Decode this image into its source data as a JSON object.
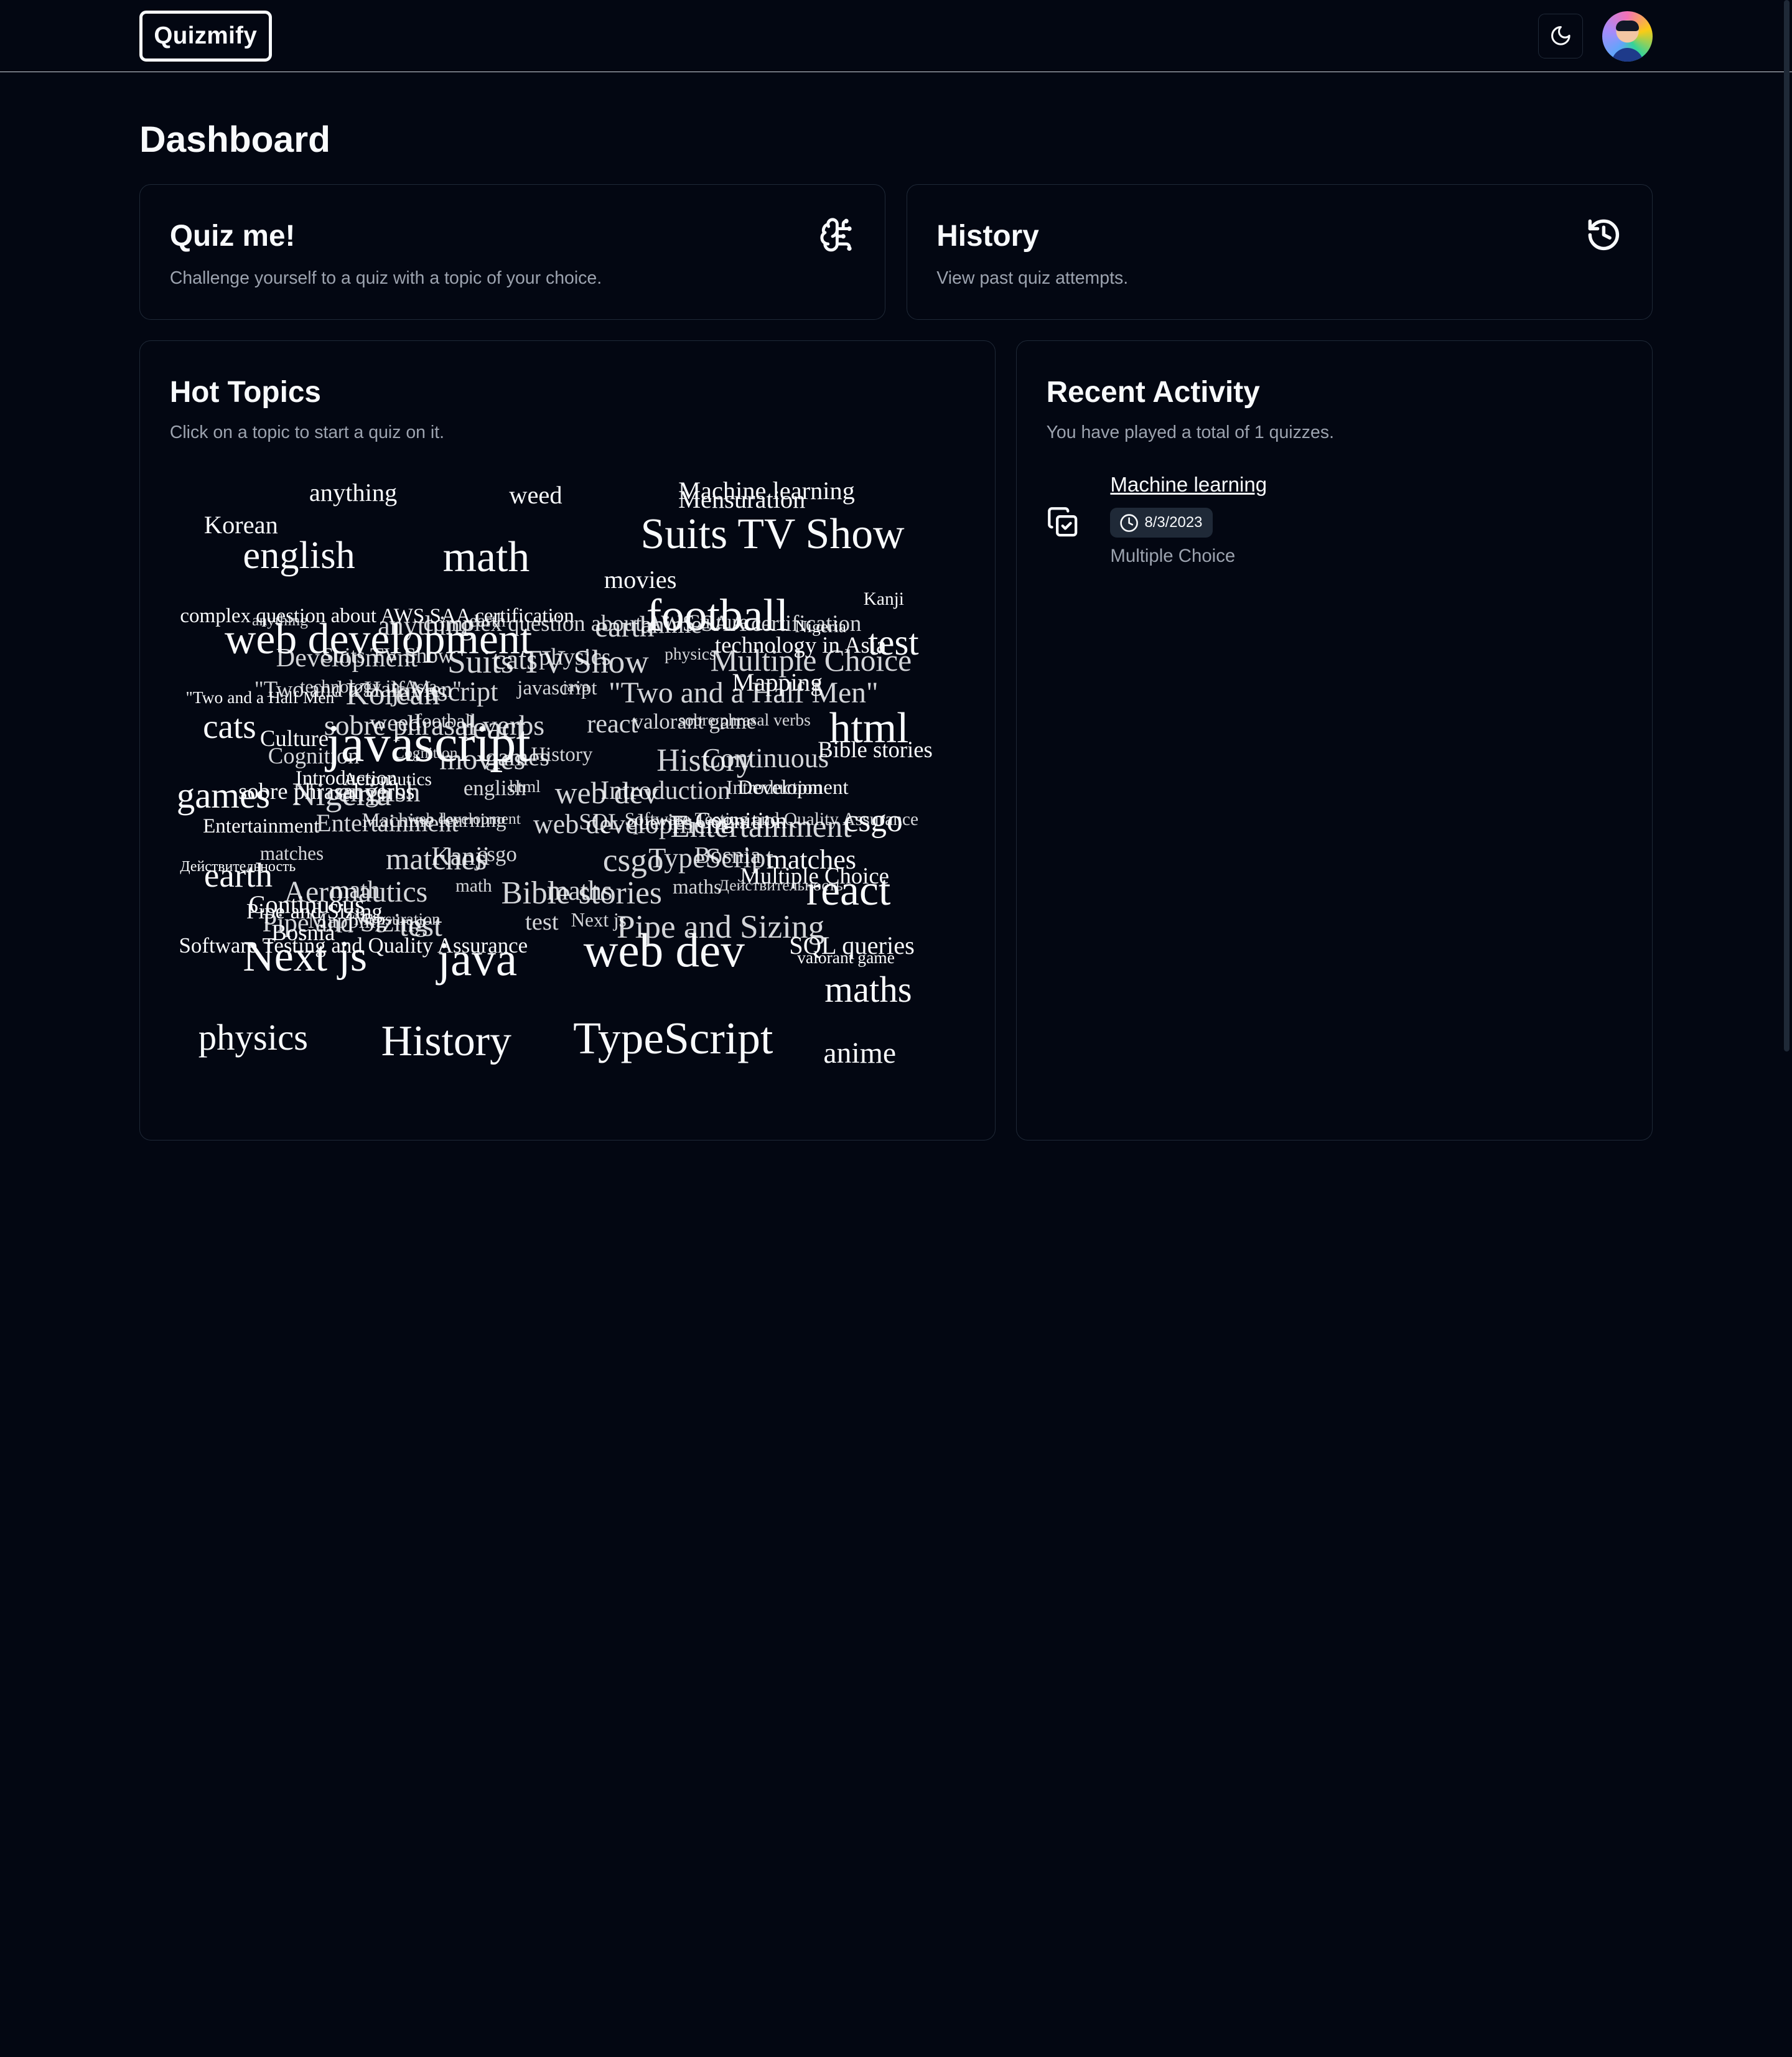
{
  "app": {
    "logo": "Quizmify"
  },
  "header": {
    "theme_toggle_icon": "moon-icon",
    "avatar_icon": "user-avatar"
  },
  "dashboard": {
    "title": "Dashboard"
  },
  "quiz_card": {
    "title": "Quiz me!",
    "description": "Challenge yourself to a quiz with a topic of your choice.",
    "icon": "brain-circuit-icon"
  },
  "history_card": {
    "title": "History",
    "description": "View past quiz attempts.",
    "icon": "history-icon"
  },
  "hot_topics": {
    "title": "Hot Topics",
    "description": "Click on a topic to start a quiz on it.",
    "topics": [
      "anything",
      "weed",
      "Machine learning",
      "Mensuration",
      "Korean",
      "english",
      "math",
      "Suits TV Show",
      "movies",
      "Kanji",
      "complex question about AWS SAA certification",
      "football",
      "web development",
      "test",
      "javascript",
      "html",
      "Bible stories",
      "cats",
      "games",
      "csgo",
      "earth",
      "react",
      "SQL queries",
      "Next js",
      "java",
      "web dev",
      "maths",
      "physics",
      "History",
      "TypeScript",
      "anime",
      "valorant game",
      "Software Testing and Quality Assurance",
      "Pipe and Sizing",
      "\"Two and a Half Men\"",
      "Introduction",
      "Действительность",
      "Multiple Choice",
      "Continuous",
      "Bosnia",
      "Culture",
      "sobre phrasal verbs",
      "Entertainment",
      "Mapping",
      "technology in Asia",
      "Nigeria",
      "Aeronautics",
      "Development",
      "Cognition",
      "matches"
    ]
  },
  "recent_activity": {
    "title": "Recent Activity",
    "summary": "You have played a total of 1 quizzes.",
    "items": [
      {
        "topic": "Machine learning",
        "date": "8/3/2023",
        "type": "Multiple Choice",
        "icon": "copy-check-icon",
        "date_icon": "clock-icon"
      }
    ]
  }
}
